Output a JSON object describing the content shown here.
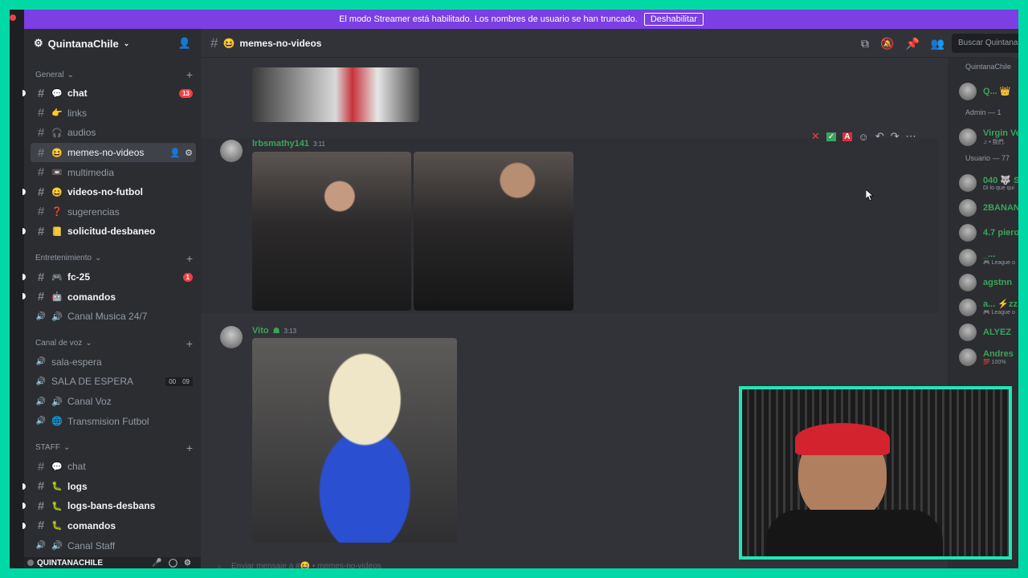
{
  "banner": {
    "text": "El modo Streamer está habilitado. Los nombres de usuario se han truncado.",
    "button": "Deshabilitar"
  },
  "server": {
    "name": "QuintanaChile"
  },
  "categories": [
    {
      "name": "General",
      "channels": [
        {
          "name": "chat",
          "emoji": "💬",
          "unread": true,
          "badge": "13"
        },
        {
          "name": "links",
          "emoji": "👉"
        },
        {
          "name": "audios",
          "emoji": "🎧"
        },
        {
          "name": "memes-no-videos",
          "emoji": "😆",
          "active": true
        },
        {
          "name": "multimedia",
          "emoji": "📼"
        },
        {
          "name": "videos-no-futbol",
          "emoji": "😄",
          "unread": true
        },
        {
          "name": "sugerencias",
          "emoji": "❓",
          "voice": false
        },
        {
          "name": "solicitud-desbaneo",
          "emoji": "📒",
          "unread": true
        }
      ]
    },
    {
      "name": "Entretenimiento",
      "channels": [
        {
          "name": "fc-25",
          "emoji": "🎮",
          "unread": true,
          "badge": "1"
        },
        {
          "name": "comandos",
          "emoji": "🤖",
          "unread": true
        },
        {
          "name": "Canal Musica 24/7",
          "emoji": "🔊"
        }
      ]
    },
    {
      "name": "Canal de voz",
      "channels": [
        {
          "name": "sala-espera",
          "emoji": ""
        },
        {
          "name": "SALA DE ESPERA",
          "emoji": "",
          "count": [
            "00",
            "09"
          ]
        },
        {
          "name": "Canal Voz",
          "emoji": "🔊"
        },
        {
          "name": "Transmision Futbol",
          "emoji": "🌐"
        }
      ]
    },
    {
      "name": "STAFF",
      "channels": [
        {
          "name": "chat",
          "emoji": "💬"
        },
        {
          "name": "logs",
          "emoji": "🐛",
          "unread": true
        },
        {
          "name": "logs-bans-desbans",
          "emoji": "🐛",
          "unread": true
        },
        {
          "name": "comandos",
          "emoji": "🐛",
          "unread": true
        },
        {
          "name": "Canal Staff",
          "emoji": "🔊"
        }
      ]
    }
  ],
  "user": {
    "name": "QUINTANACHILE"
  },
  "channel_header": {
    "name": "memes-no-videos",
    "emoji": "😆",
    "search_placeholder": "Buscar Quintana"
  },
  "messages": [
    {
      "author": "lrbsmathy141",
      "time": "3:11"
    },
    {
      "author": "Vito",
      "time": "3:13"
    }
  ],
  "composer": {
    "placeholder": "Enviar mensaje a #😆 • memes-no-videos"
  },
  "members": {
    "groups": [
      {
        "label": "QuintanaChile",
        "members": [
          {
            "name": "Q... 👑",
            "sub": ""
          }
        ]
      },
      {
        "label": "Admin — 1",
        "members": [
          {
            "name": "Virgin Ve",
            "sub": "♫ • 我們."
          }
        ]
      },
      {
        "label": "Usuario — 77",
        "members": [
          {
            "name": "040 🐺 S",
            "sub": "Di lo que qui"
          },
          {
            "name": "2BANAN",
            "sub": ""
          },
          {
            "name": "4.7 piero",
            "sub": ""
          },
          {
            "name": "_...",
            "sub": "🎮 League o"
          },
          {
            "name": "agstnn",
            "sub": ""
          },
          {
            "name": "a... ⚡zz",
            "sub": "🎮 League o"
          },
          {
            "name": "ALYEZ",
            "sub": ""
          },
          {
            "name": "Andres",
            "sub": "💯 100%"
          }
        ]
      }
    ]
  },
  "colors": {
    "accent_bar": "#00d9a6",
    "banner": "#7b3fe4",
    "online": "#3ba55c",
    "badge": "#f23f43"
  }
}
